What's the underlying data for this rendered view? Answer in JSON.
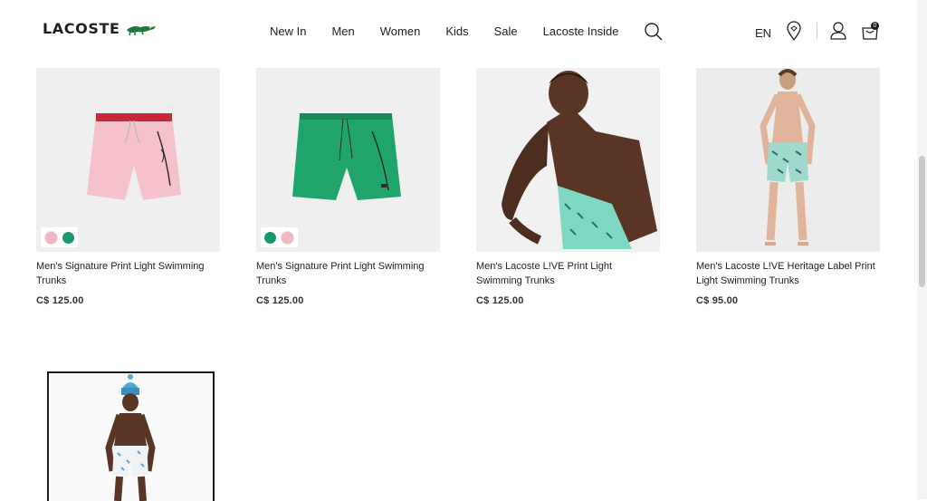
{
  "header": {
    "logo": "LACOSTE",
    "nav": [
      "New In",
      "Men",
      "Women",
      "Kids",
      "Sale",
      "Lacoste Inside"
    ],
    "language": "EN",
    "bag_count": "0"
  },
  "products": [
    {
      "name": "Men's Signature Print Light Swimming Trunks",
      "price": "C$ 125.00",
      "swatches": [
        "#f2b6bf",
        "#1a9a6c"
      ]
    },
    {
      "name": "Men's Signature Print Light Swimming Trunks",
      "price": "C$ 125.00",
      "swatches": [
        "#1a9a6c",
        "#f2b6bf"
      ]
    },
    {
      "name": "Men's Lacoste L!VE Print Light Swimming Trunks",
      "price": "C$ 125.00",
      "swatches": []
    },
    {
      "name": "Men's Lacoste L!VE Heritage Label Print Light Swimming Trunks",
      "price": "C$ 95.00",
      "swatches": []
    }
  ],
  "colors": {
    "pink_trunks": "#f5c2cc",
    "green_trunks": "#1fa56a",
    "mint_print": "#7fd8c1",
    "skin": "#5a3526",
    "skin_light": "#e0b49a"
  }
}
